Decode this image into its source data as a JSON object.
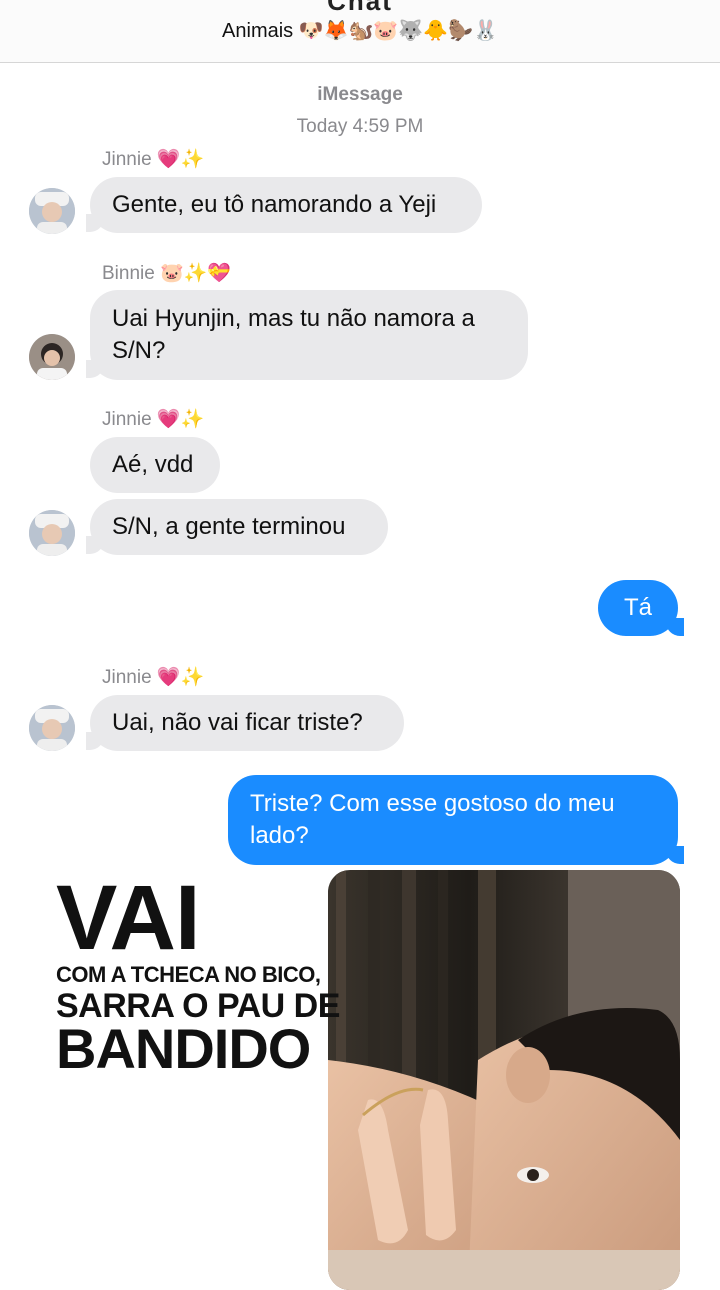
{
  "header": {
    "group_name": "Chat",
    "subtitle": "Animais 🐶🦊🐿️🐷🐺🐥🦫🐰"
  },
  "conversation": {
    "service": "iMessage",
    "timestamp": "Today 4:59 PM"
  },
  "messages": [
    {
      "sender": "Jinnie 💗✨",
      "text": "Gente, eu tô namorando a Yeji"
    },
    {
      "sender": "Binnie 🐷✨💝",
      "text": "Uai Hyunjin, mas tu não namora a S/N?"
    },
    {
      "sender": "Jinnie 💗✨",
      "text": "Aé, vdd"
    },
    {
      "text": "S/N, a gente terminou"
    },
    {
      "text": "Tá"
    },
    {
      "sender": "Jinnie 💗✨",
      "text": "Uai, não vai ficar triste?"
    },
    {
      "text": "Triste? Com esse gostoso do meu lado?"
    }
  ],
  "overlay": {
    "line1": "VAI",
    "line2": "COM A TCHECA NO BICO,",
    "line3": "SARRA O PAU DE",
    "line4": "BANDIDO"
  },
  "colors": {
    "incoming_bubble": "#e9e9eb",
    "outgoing_bubble": "#1a8cff",
    "meta_text": "#8a8a8e"
  }
}
